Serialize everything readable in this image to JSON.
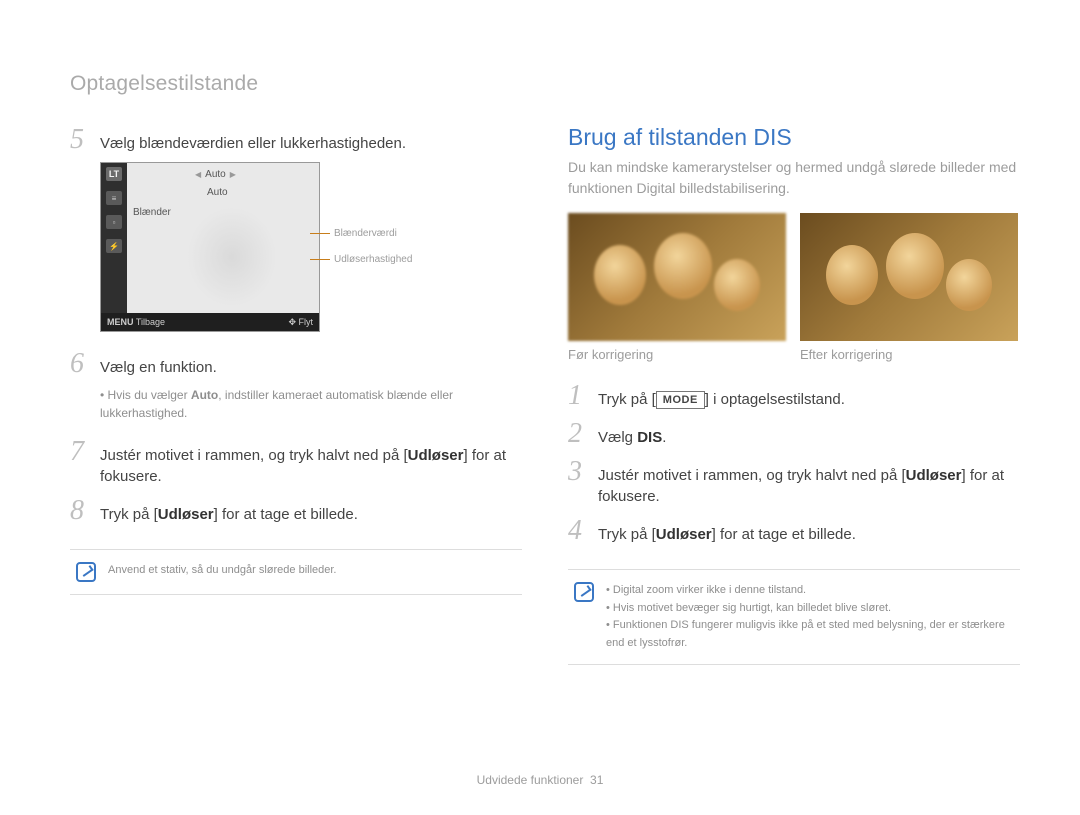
{
  "header": "Optagelsestilstande",
  "footer": {
    "section": "Udvidede funktioner",
    "page": "31"
  },
  "left": {
    "step5": {
      "num": "5",
      "text": "Vælg blændeværdien eller lukkerhastigheden."
    },
    "lcd": {
      "lt": "LT",
      "row1_label": "",
      "row1_val": "Auto",
      "row2_label": "",
      "row2_val": "Auto",
      "mode_label": "Blænder",
      "status_left": "Tilbage",
      "status_right": "Flyt",
      "menu": "MENU"
    },
    "annot1": "Blænderværdi",
    "annot2": "Udløserhastighed",
    "step6": {
      "num": "6",
      "text": "Vælg en funktion."
    },
    "step6_sub": "Hvis du vælger Auto, indstiller kameraet automatisk blænde eller lukkerhastighed.",
    "step6_sub_bold": "Auto",
    "step7": {
      "num": "7",
      "pre": "Justér motivet i rammen, og tryk halvt ned på [",
      "bold": "Udløser",
      "post": "] for at fokusere."
    },
    "step8": {
      "num": "8",
      "pre": "Tryk på [",
      "bold": "Udløser",
      "post": "] for at tage et billede."
    },
    "tip": "Anvend et stativ, så du undgår slørede billeder."
  },
  "right": {
    "h2": "Brug af tilstanden DIS",
    "intro": "Du kan mindske kamerarystelser og hermed undgå slørede billeder med funktionen Digital billedstabilisering.",
    "cap1": "Før korrigering",
    "cap2": "Efter korrigering",
    "step1": {
      "num": "1",
      "pre": "Tryk på [",
      "mode": "MODE",
      "post": "] i optagelsestilstand."
    },
    "step2": {
      "num": "2",
      "pre": "Vælg ",
      "bold": "DIS",
      "post": "."
    },
    "step3": {
      "num": "3",
      "pre": "Justér motivet i rammen, og tryk halvt ned på [",
      "bold": "Udløser",
      "post": "] for at fokusere."
    },
    "step4": {
      "num": "4",
      "pre": "Tryk på [",
      "bold": "Udløser",
      "post": "] for at tage et billede."
    },
    "tips": [
      "Digital zoom virker ikke i denne tilstand.",
      "Hvis motivet bevæger sig hurtigt, kan billedet blive sløret.",
      "Funktionen DIS fungerer muligvis ikke på et sted med belysning, der er stærkere end et lysstofrør."
    ]
  }
}
